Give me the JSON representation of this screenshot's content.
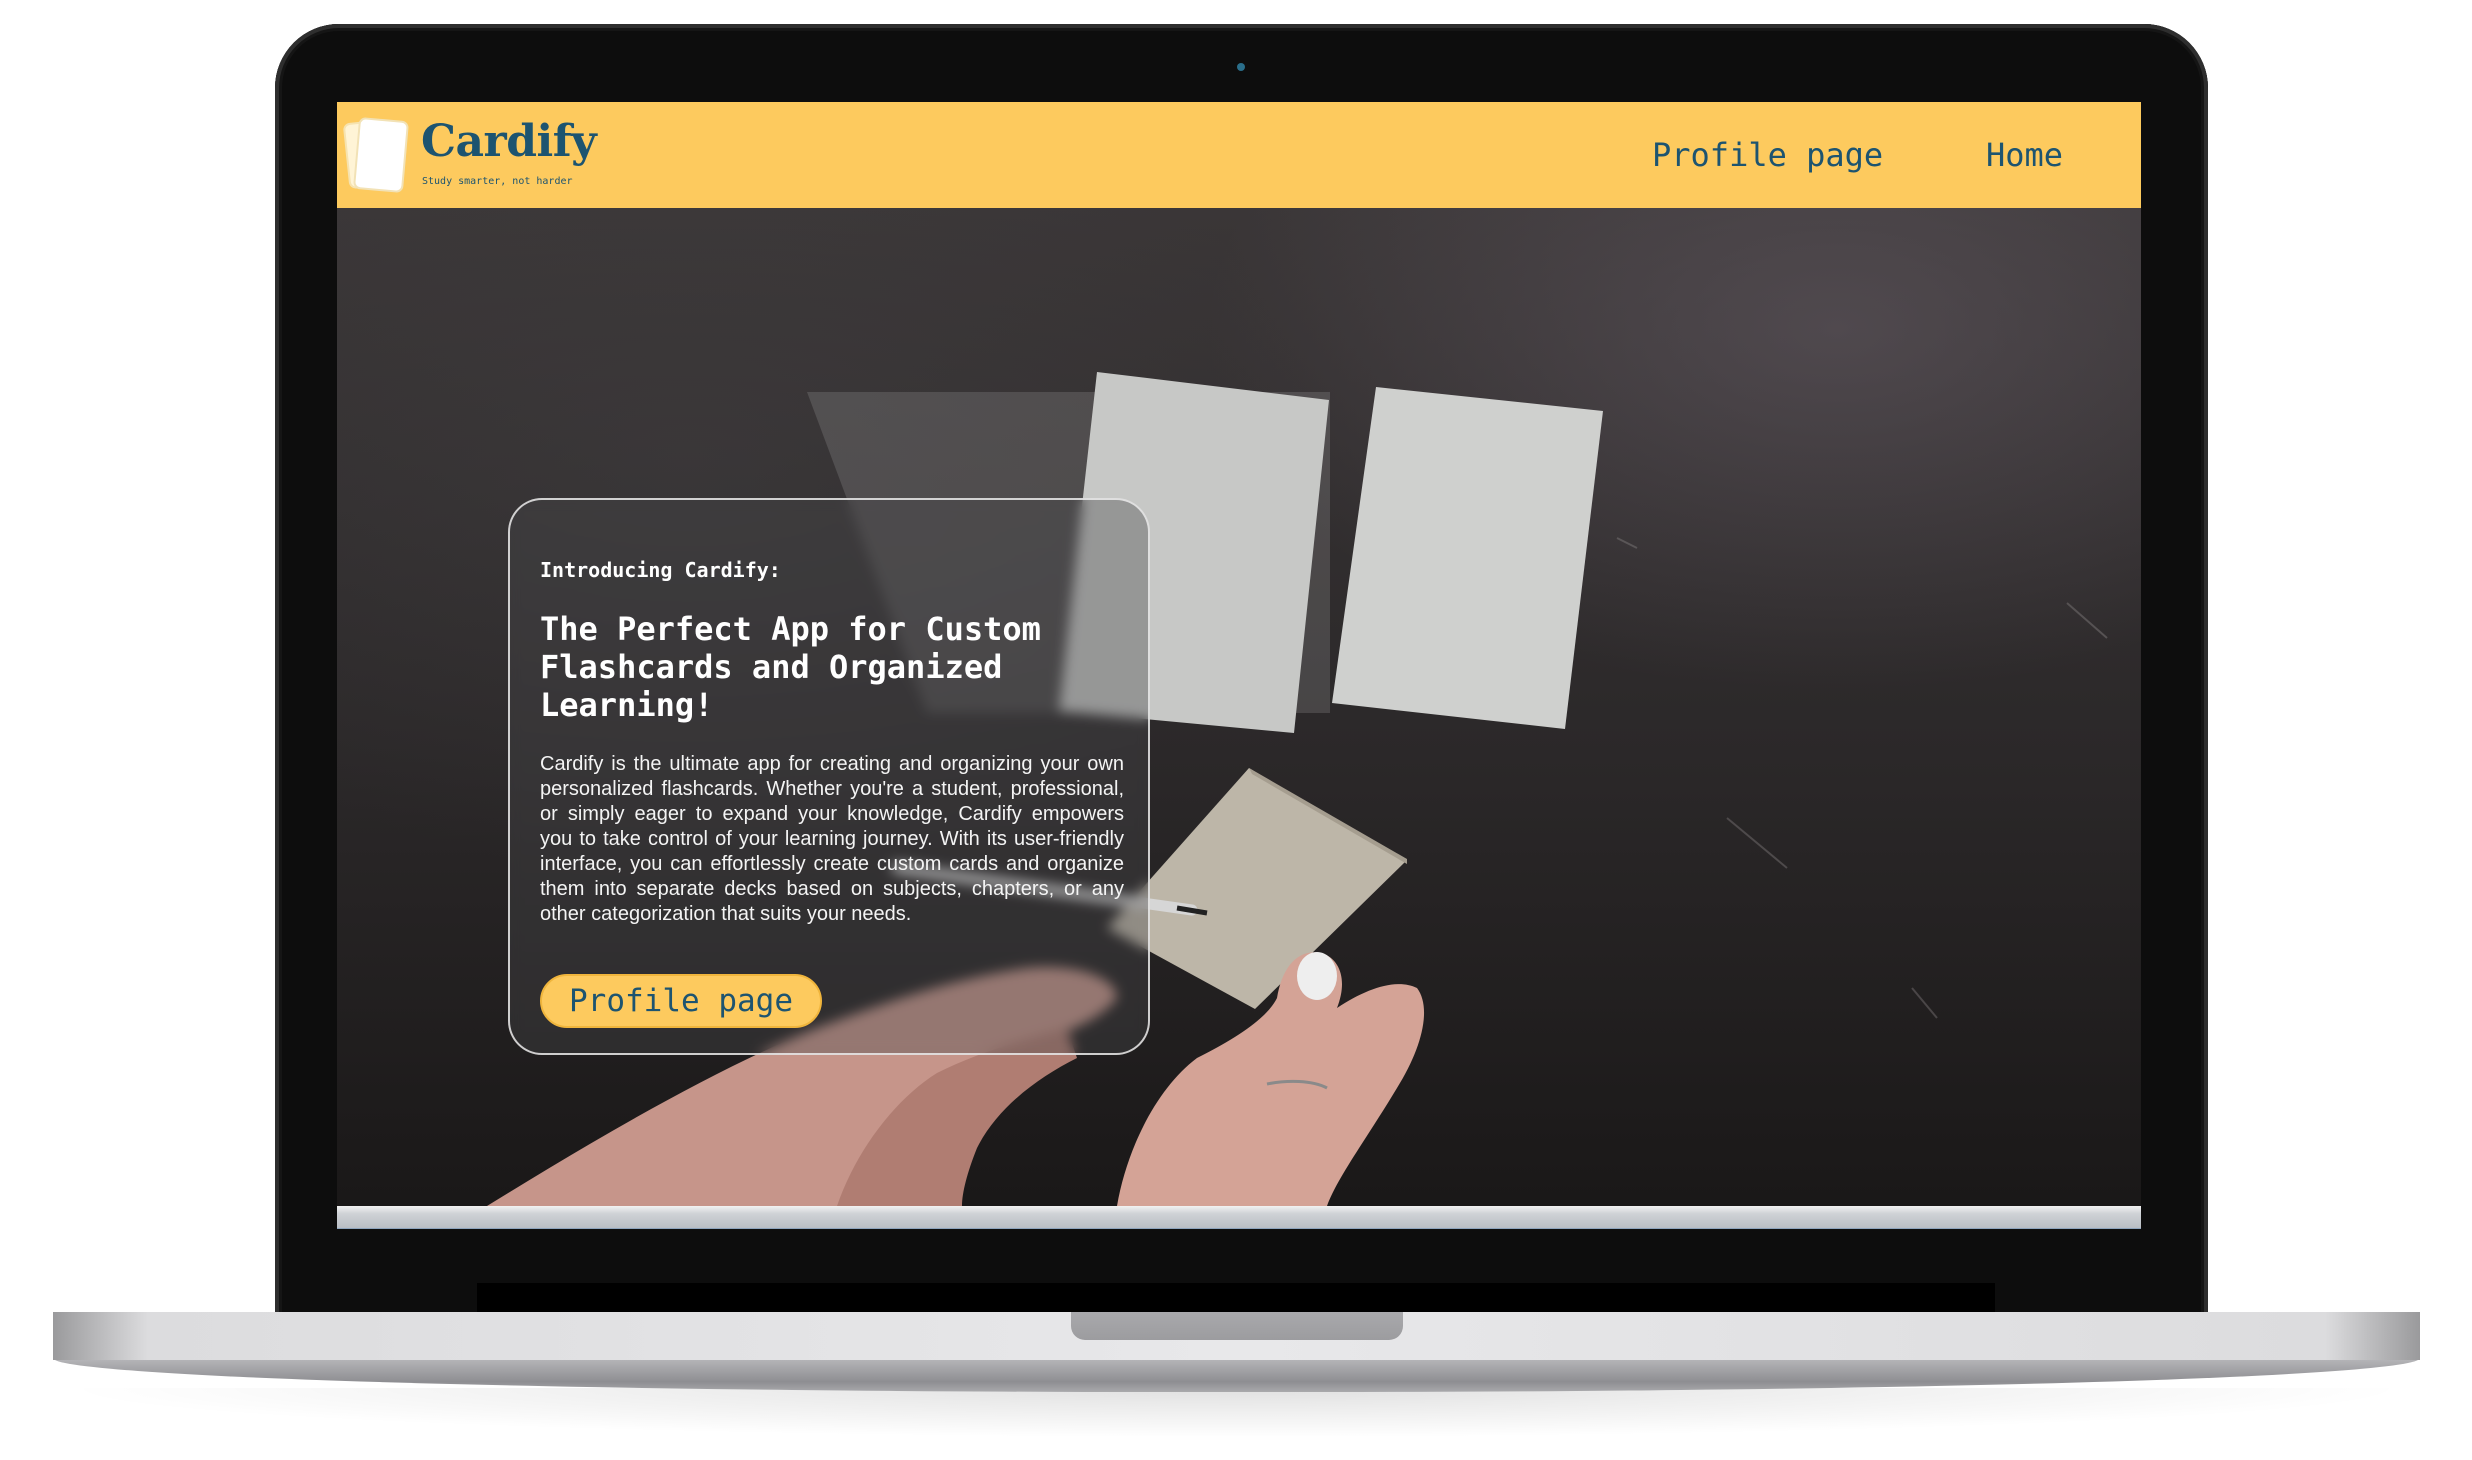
{
  "navbar": {
    "brand": "Cardify",
    "tagline": "Study smarter, not harder",
    "links": [
      "Profile page",
      "Home"
    ]
  },
  "hero": {
    "eyebrow": "Introducing Cardify:",
    "title": "The Perfect App for Custom Flashcards and Organized Learning!",
    "body": "Cardify is the ultimate app for creating and organizing your own personalized flashcards. Whether you're a student, professional, or simply eager to expand your knowledge, Cardify empowers you to take control of your learning journey. With its user-friendly interface, you can effortlessly create custom cards and organize them into separate decks based on subjects, chapters, or any other categorization that suits your needs.",
    "button_label": "Profile page"
  },
  "colors": {
    "navbar_bg": "#fdca5e",
    "brand_text": "#1d5470",
    "button_bg": "#fdca5e",
    "laptop_bezel": "#0d0d0d"
  },
  "icons": {
    "logo": "stacked-cards-logo-icon",
    "camera": "webcam-dot"
  }
}
